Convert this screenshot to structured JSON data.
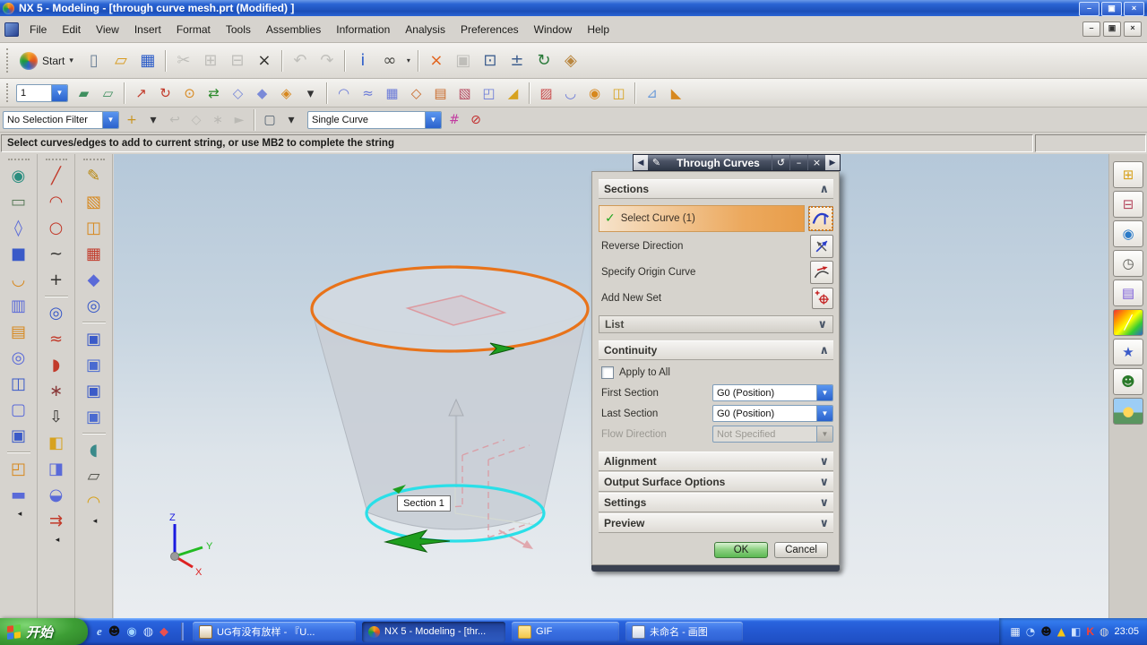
{
  "titlebar": {
    "title": "NX 5 - Modeling - [through curve mesh.prt (Modified) ]",
    "minimize": "–",
    "restore": "▣",
    "close": "×"
  },
  "menubar": {
    "items": [
      "File",
      "Edit",
      "View",
      "Insert",
      "Format",
      "Tools",
      "Assemblies",
      "Information",
      "Analysis",
      "Preferences",
      "Window",
      "Help"
    ]
  },
  "toolbars": {
    "start_label": "Start",
    "layer_value": "1",
    "selection_filter_value": "No Selection Filter",
    "curve_rule_value": "Single Curve",
    "row1_icons": [
      {
        "name": "new-file-icon",
        "glyph": "▯",
        "color": "#6b7f96"
      },
      {
        "name": "open-file-icon",
        "glyph": "▱",
        "color": "#d79a1e"
      },
      {
        "name": "save-icon",
        "glyph": "▦",
        "color": "#2a5bc8"
      },
      {
        "sep": true
      },
      {
        "name": "cut-icon",
        "glyph": "✂",
        "color": "#8f8f8b",
        "dim": true
      },
      {
        "name": "copy-icon",
        "glyph": "⊞",
        "color": "#8f8f8b",
        "dim": true
      },
      {
        "name": "paste-icon",
        "glyph": "⊟",
        "color": "#8f8f8b",
        "dim": true
      },
      {
        "name": "delete-icon",
        "glyph": "×",
        "color": "#33322f"
      },
      {
        "sep": true
      },
      {
        "name": "undo-icon",
        "glyph": "↶",
        "color": "#8f8f8b",
        "dim": true
      },
      {
        "name": "redo-icon",
        "glyph": "↷",
        "color": "#8f8f8b",
        "dim": true
      },
      {
        "sep": true
      },
      {
        "name": "information-icon",
        "glyph": "i",
        "color": "#2a5bc8"
      },
      {
        "name": "find-icon",
        "glyph": "∞",
        "color": "#4a4a46"
      },
      {
        "name": "find-options-arrow",
        "glyph": "▾",
        "color": "#333",
        "cls": "mini"
      },
      {
        "sep": true
      },
      {
        "name": "fit-view-icon",
        "glyph": "×",
        "color": "#e2641e"
      },
      {
        "name": "zoom-box-icon",
        "glyph": "▣",
        "color": "#8f8f8b",
        "dim": true
      },
      {
        "name": "zoom-icon",
        "glyph": "⊡",
        "color": "#3f5f8f"
      },
      {
        "name": "zoom-in-out-icon",
        "glyph": "±",
        "color": "#3f5f8f"
      },
      {
        "name": "rotate-view-icon",
        "glyph": "↻",
        "color": "#2a7a3a"
      },
      {
        "name": "pan-view-icon",
        "glyph": "◈",
        "color": "#b9863f"
      }
    ],
    "row2_icons": [
      {
        "name": "layer-settings-icon",
        "glyph": "▰",
        "color": "#3f8f5f"
      },
      {
        "name": "layer-visible-in-view-icon",
        "glyph": "▱",
        "color": "#3f8f5f"
      },
      {
        "sep": true
      },
      {
        "name": "wcs-dynamics-icon",
        "glyph": "↗",
        "color": "#c23a2a"
      },
      {
        "name": "wcs-rotate-icon",
        "glyph": "↻",
        "color": "#c23a2a"
      },
      {
        "name": "wcs-origin-icon",
        "glyph": "⊙",
        "color": "#d7881e"
      },
      {
        "name": "orient-wcs-icon",
        "glyph": "⇄",
        "color": "#2a8a2a"
      },
      {
        "name": "datum-plane-icon",
        "glyph": "◇",
        "color": "#7a8ad8"
      },
      {
        "name": "datum-axis-icon",
        "glyph": "◆",
        "color": "#7a8ad8"
      },
      {
        "name": "datum-csys-icon",
        "glyph": "◈",
        "color": "#d7881e"
      },
      {
        "name": "more-datum-arrow",
        "glyph": "▾",
        "color": "#333",
        "cls": "mini"
      },
      {
        "sep": true
      },
      {
        "name": "ruled-surface-icon",
        "glyph": "◠",
        "color": "#6a7ad8"
      },
      {
        "name": "through-curves-icon",
        "glyph": "≈",
        "color": "#6a7ad8"
      },
      {
        "name": "through-curve-mesh-icon",
        "glyph": "▦",
        "color": "#6a7ad8"
      },
      {
        "name": "swept-surface-icon",
        "glyph": "◇",
        "color": "#c96a2a"
      },
      {
        "name": "section-surface-icon",
        "glyph": "▤",
        "color": "#c96a2a"
      },
      {
        "name": "n-sided-surface-icon",
        "glyph": "▧",
        "color": "#b5485f"
      },
      {
        "name": "bounded-plane-icon",
        "glyph": "◰",
        "color": "#6a7ad8"
      },
      {
        "name": "law-extension-icon",
        "glyph": "◢",
        "color": "#d7a21e"
      },
      {
        "sep": true
      },
      {
        "name": "studio-surface-icon",
        "glyph": "▨",
        "color": "#c94a4a"
      },
      {
        "name": "styled-blend-icon",
        "glyph": "◡",
        "color": "#6a7ad8"
      },
      {
        "name": "styled-sweep-icon",
        "glyph": "◉",
        "color": "#d7881e"
      },
      {
        "name": "four-point-surface-icon",
        "glyph": "◫",
        "color": "#d7a21e"
      },
      {
        "sep": true
      },
      {
        "name": "offset-surface-icon",
        "glyph": "⊿",
        "color": "#6a9ad8"
      },
      {
        "name": "trimmed-sheet-icon",
        "glyph": "◣",
        "color": "#d7881e"
      }
    ],
    "selection_icons_a": [
      {
        "name": "snap-point-options-icon",
        "glyph": "+",
        "color": "#c9941e"
      },
      {
        "name": "snap-options-arrow",
        "glyph": "▾",
        "color": "#333",
        "cls": "mini"
      },
      {
        "name": "undo-selection-icon",
        "glyph": "↩",
        "color": "#9a9a96",
        "dim": true
      },
      {
        "name": "solid-preselect-icon",
        "glyph": "◇",
        "color": "#9a9a96",
        "dim": true
      },
      {
        "name": "snap-point-icon",
        "glyph": "∗",
        "color": "#9a9a96",
        "dim": true
      },
      {
        "name": "highlight-icon",
        "glyph": "►",
        "color": "#9a9a96",
        "dim": true
      },
      {
        "sep": true
      },
      {
        "name": "rectangle-select-icon",
        "glyph": "▢",
        "color": "#4a5a6a"
      },
      {
        "name": "select-options-arrow",
        "glyph": "▾",
        "color": "#333",
        "cls": "mini"
      }
    ],
    "selection_icons_b": [
      {
        "name": "intersection-stop-icon",
        "glyph": "#",
        "color": "#c23aa0"
      },
      {
        "name": "no-snap-icon",
        "glyph": "⊘",
        "color": "#c22a2a"
      }
    ]
  },
  "prompt": "Select curves/edges to add to current string, or use MB2 to complete the string",
  "left_toolbox": {
    "col1": [
      {
        "name": "point-shapes-icon",
        "glyph": "◉",
        "color": "#2a8d7f"
      },
      {
        "name": "rectangle-icon",
        "glyph": "▭",
        "color": "#5a7a5a"
      },
      {
        "name": "four-sided-surface-icon",
        "glyph": "◊",
        "color": "#5a6ad8"
      },
      {
        "name": "block-icon",
        "glyph": "■",
        "color": "#3a5ac8"
      },
      {
        "name": "swoop-sheet-icon",
        "glyph": "◡",
        "color": "#d7881e"
      },
      {
        "name": "extrude-icon",
        "glyph": "▥",
        "color": "#5a6ad8"
      },
      {
        "name": "sheet-body-icon",
        "glyph": "▤",
        "color": "#d7881e"
      },
      {
        "name": "revolve-icon",
        "glyph": "◎",
        "color": "#5a6ad8"
      },
      {
        "name": "cylinder-pair-icon",
        "glyph": "◫",
        "color": "#3a5ac8"
      },
      {
        "name": "bounded-sheet-icon",
        "glyph": "▢",
        "color": "#5a6ad8"
      },
      {
        "name": "block-with-hole-icon",
        "glyph": "▣",
        "color": "#3a5ac8"
      },
      {
        "sep": true
      },
      {
        "name": "box-frame-icon",
        "glyph": "◰",
        "color": "#d7881e"
      },
      {
        "name": "flat-sheet-icon",
        "glyph": "▬",
        "color": "#5a6ad8"
      },
      {
        "name": "scroll-left-icon",
        "glyph": "◂",
        "color": "#222",
        "cls": "mini"
      }
    ],
    "col2": [
      {
        "name": "line-icon",
        "glyph": "╱",
        "color": "#c23a2a"
      },
      {
        "name": "arc-icon",
        "glyph": "◠",
        "color": "#c23a2a"
      },
      {
        "name": "circle-icon",
        "glyph": "○",
        "color": "#c23a2a"
      },
      {
        "name": "spline-icon",
        "glyph": "~",
        "color": "#33322f"
      },
      {
        "name": "point-icon",
        "glyph": "+",
        "color": "#33322f"
      },
      {
        "sep": true
      },
      {
        "name": "helix-icon",
        "glyph": "◎",
        "color": "#3a5ac8"
      },
      {
        "name": "law-curve-icon",
        "glyph": "≈",
        "color": "#c23a2a"
      },
      {
        "name": "profile-icon",
        "glyph": "◗",
        "color": "#c23a2a"
      },
      {
        "name": "curve-on-surface-icon",
        "glyph": "∗",
        "color": "#8a3a3a"
      },
      {
        "name": "project-curve-icon",
        "glyph": "⇩",
        "color": "#33322f"
      },
      {
        "name": "combine-curve-icon",
        "glyph": "◧",
        "color": "#d7a21e"
      },
      {
        "name": "wrap-curve-icon",
        "glyph": "◨",
        "color": "#5a6ad8"
      },
      {
        "name": "intersect-curve-icon",
        "glyph": "◒",
        "color": "#5a6ad8"
      },
      {
        "name": "offset-curve-icon",
        "glyph": "⇉",
        "color": "#c23a2a"
      },
      {
        "name": "scroll-left-icon",
        "glyph": "◂",
        "color": "#222",
        "cls": "mini"
      }
    ],
    "col3": [
      {
        "name": "sketch-icon",
        "glyph": "✎",
        "color": "#b8860b"
      },
      {
        "name": "datum-box-icon",
        "glyph": "▧",
        "color": "#d7881e"
      },
      {
        "name": "split-body-icon",
        "glyph": "◫",
        "color": "#d7881e"
      },
      {
        "name": "mesh-surface-icon",
        "glyph": "▦",
        "color": "#c23a2a"
      },
      {
        "name": "corner-blend-icon",
        "glyph": "◆",
        "color": "#5a6ad8"
      },
      {
        "name": "tube-icon",
        "glyph": "◎",
        "color": "#3a5ac8"
      },
      {
        "sep": true
      },
      {
        "name": "boss-icon",
        "glyph": "▣",
        "color": "#3a5ac8"
      },
      {
        "name": "pocket-icon",
        "glyph": "▣",
        "color": "#4a6ad0"
      },
      {
        "name": "pad-icon",
        "glyph": "▣",
        "color": "#3a5ac8"
      },
      {
        "name": "hole-icon",
        "glyph": "▣",
        "color": "#4a6ad0"
      },
      {
        "sep": true
      },
      {
        "name": "offset-sheet-icon",
        "glyph": "◖",
        "color": "#3a8a8a"
      },
      {
        "name": "flatten-icon",
        "glyph": "▱",
        "color": "#55564f"
      },
      {
        "name": "bend-sheet-icon",
        "glyph": "◠",
        "color": "#d7a21e"
      },
      {
        "name": "scroll-left-icon",
        "glyph": "◂",
        "color": "#222",
        "cls": "mini"
      }
    ]
  },
  "resource_bar": [
    {
      "name": "assembly-navigator-icon",
      "glyph": "⊞",
      "color": "#d7a21e"
    },
    {
      "name": "constraint-navigator-icon",
      "glyph": "⊟",
      "color": "#b5485f"
    },
    {
      "name": "part-navigator-icon",
      "glyph": "◉",
      "color": "#2a7ac8"
    },
    {
      "name": "history-icon",
      "glyph": "◷",
      "color": "#555550"
    },
    {
      "name": "materials-icon",
      "glyph": "▤",
      "color": "#7a5ad8"
    },
    {
      "name": "visualization-icon",
      "glyph": "╱",
      "color": "#ffffff",
      "cls": "rainbow"
    },
    {
      "name": "scene-wand-icon",
      "glyph": "★",
      "color": "#3a5ac8"
    },
    {
      "name": "roles-icon",
      "glyph": "☻",
      "color": "#2a7a2a"
    },
    {
      "name": "gallery-icon",
      "glyph": "●",
      "color": "#ffd75a",
      "cls": "landscape"
    }
  ],
  "viewport": {
    "section_label": "Section 1",
    "axis_x": "X",
    "axis_y": "Y",
    "axis_z": "Z"
  },
  "dialog": {
    "title": "Through Curves",
    "groups": {
      "sections": "Sections",
      "continuity": "Continuity"
    },
    "select_curve_label": "Select Curve (1)",
    "reverse_direction_label": "Reverse Direction",
    "specify_origin_curve_label": "Specify Origin Curve",
    "add_new_set_label": "Add New Set",
    "list_label": "List",
    "apply_to_all_label": "Apply to All",
    "first_section_label": "First Section",
    "first_section_value": "G0 (Position)",
    "last_section_label": "Last Section",
    "last_section_value": "G0 (Position)",
    "flow_direction_label": "Flow Direction",
    "flow_direction_value": "Not Specified",
    "collapsed_groups": [
      "Alignment",
      "Output Surface Options",
      "Settings",
      "Preview"
    ],
    "ok_label": "OK",
    "cancel_label": "Cancel"
  },
  "taskbar": {
    "start_label": "开始",
    "buttons": [
      {
        "label": "UG有没有放样 - 『U..."
      },
      {
        "label": "NX 5 - Modeling - [thr...",
        "active": true
      },
      {
        "label": "GIF"
      },
      {
        "label": "未命名 - 画图"
      }
    ],
    "clock": "23:05"
  },
  "colors": {
    "accent_orange": "#e8731a",
    "accent_cyan": "#2adfe8",
    "selection_highlight": "#eca95e",
    "ok_green": "#8fd284",
    "titlebar_blue": "#2a64d4",
    "taskbar_blue": "#2459d2"
  }
}
